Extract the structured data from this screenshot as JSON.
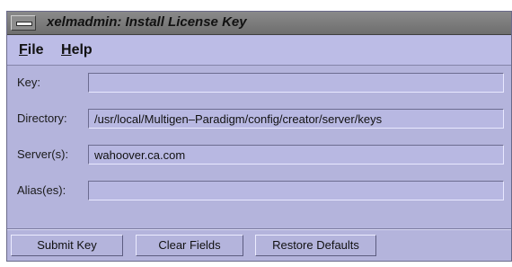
{
  "window": {
    "title": "xelmadmin: Install License Key"
  },
  "menu": {
    "file": {
      "mnemonic": "F",
      "rest": "ile"
    },
    "help": {
      "mnemonic": "H",
      "rest": "elp"
    }
  },
  "form": {
    "key": {
      "label": "Key:",
      "value": ""
    },
    "directory": {
      "label": "Directory:",
      "value": "/usr/local/Multigen–Paradigm/config/creator/server/keys"
    },
    "servers": {
      "label": "Server(s):",
      "value": "wahoover.ca.com"
    },
    "aliases": {
      "label": "Alias(es):",
      "value": ""
    }
  },
  "buttons": {
    "submit": "Submit Key",
    "clear": "Clear Fields",
    "restore": "Restore Defaults"
  }
}
